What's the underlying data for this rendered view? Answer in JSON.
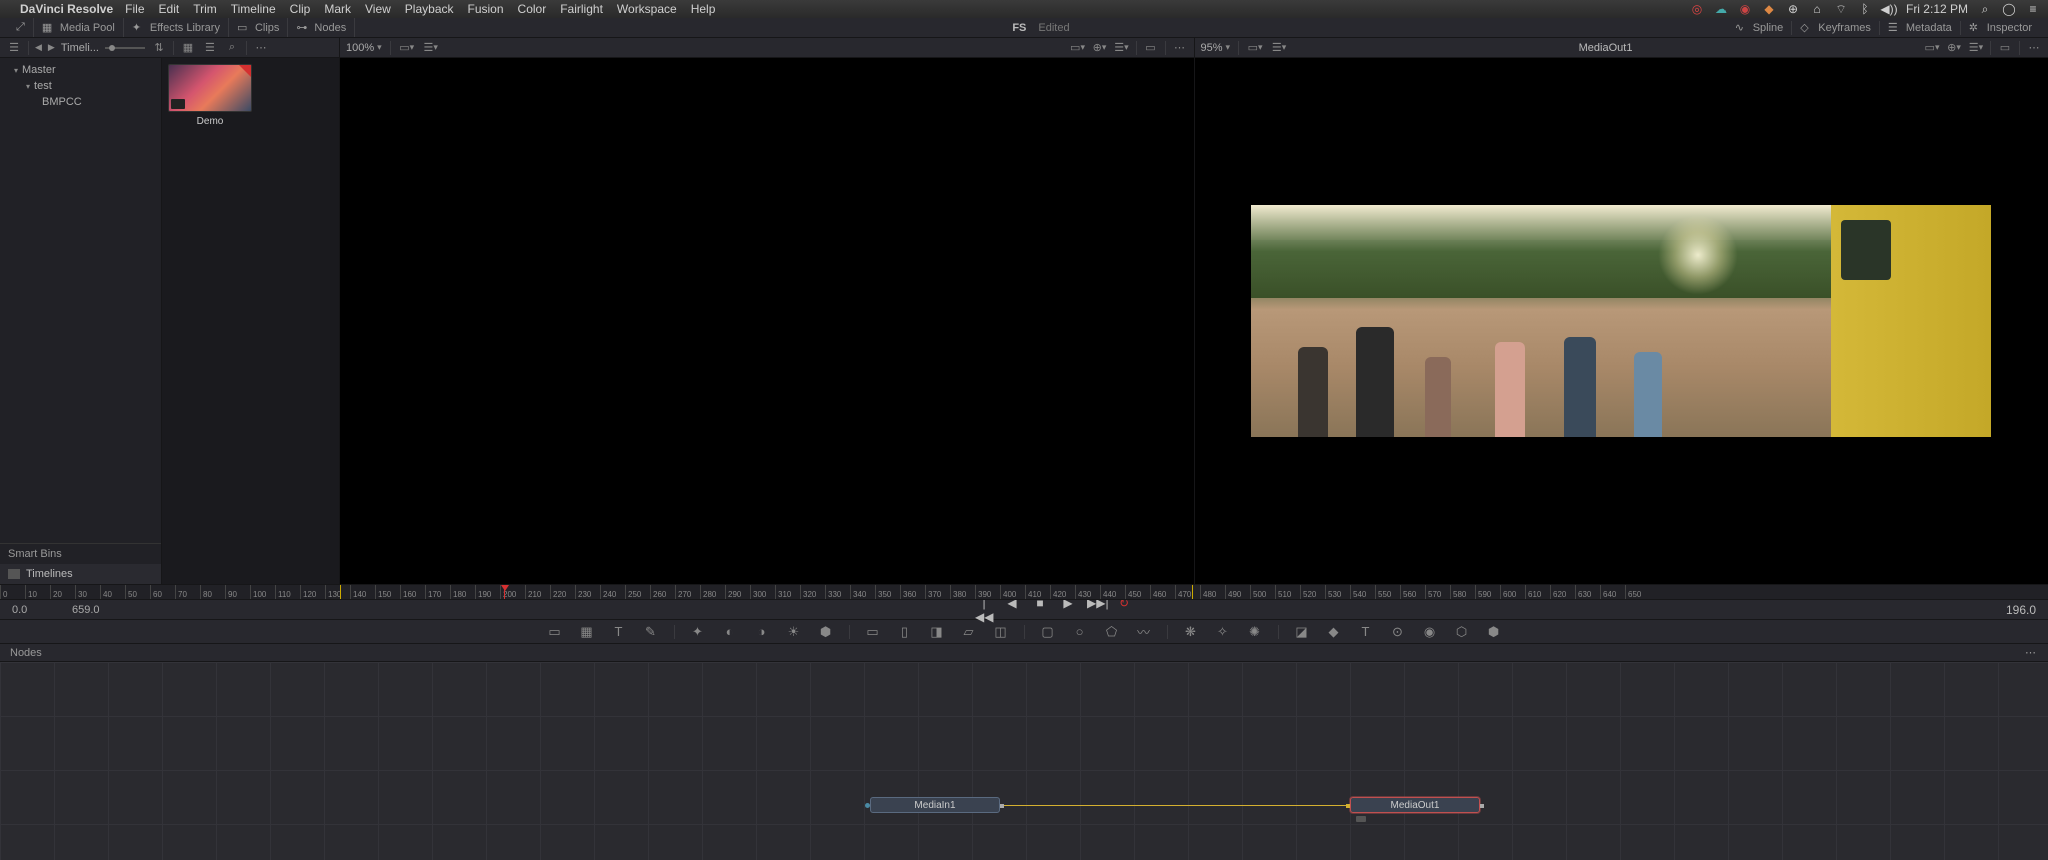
{
  "macos": {
    "app_name": "DaVinci Resolve",
    "menus": [
      "File",
      "Edit",
      "Trim",
      "Timeline",
      "Clip",
      "Mark",
      "View",
      "Playback",
      "Fusion",
      "Color",
      "Fairlight",
      "Workspace",
      "Help"
    ],
    "clock": "Fri 2:12 PM"
  },
  "toolbar": {
    "media_pool": "Media Pool",
    "effects_library": "Effects Library",
    "clips": "Clips",
    "nodes": "Nodes",
    "fs_label": "FS",
    "edited": "Edited",
    "spline": "Spline",
    "keyframes": "Keyframes",
    "metadata": "Metadata",
    "inspector": "Inspector"
  },
  "subbar": {
    "timeline_label": "Timeli...",
    "zoom_left": "100%",
    "zoom_right": "95%",
    "right_title": "MediaOut1"
  },
  "sidebar": {
    "master": "Master",
    "test": "test",
    "bmpcc": "BMPCC",
    "smart_bins": "Smart Bins",
    "timelines": "Timelines"
  },
  "clip": {
    "label": "Demo"
  },
  "ruler": {
    "ticks": [
      "0",
      "10",
      "20",
      "30",
      "40",
      "50",
      "60",
      "70",
      "80",
      "90",
      "100",
      "110",
      "120",
      "130",
      "140",
      "150",
      "160",
      "170",
      "180",
      "190",
      "200",
      "210",
      "220",
      "230",
      "240",
      "250",
      "260",
      "270",
      "280",
      "290",
      "300",
      "310",
      "320",
      "330",
      "340",
      "350",
      "360",
      "370",
      "380",
      "390",
      "400",
      "410",
      "420",
      "430",
      "440",
      "450",
      "460",
      "470",
      "480",
      "490",
      "500",
      "510",
      "520",
      "530",
      "540",
      "550",
      "560",
      "570",
      "580",
      "590",
      "600",
      "610",
      "620",
      "630",
      "640",
      "650"
    ]
  },
  "transport": {
    "start": "0.0",
    "end": "659.0",
    "current": "196.0"
  },
  "nodes": {
    "header": "Nodes",
    "media_in": "MediaIn1",
    "media_out": "MediaOut1"
  }
}
